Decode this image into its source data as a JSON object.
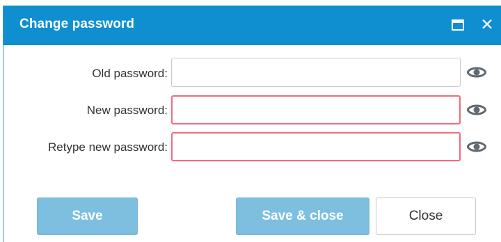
{
  "dialog": {
    "title": "Change password",
    "icons": {
      "maximize": "maximize-icon",
      "close": "close-icon",
      "show_password": "eye-icon"
    },
    "close_glyph": "✕"
  },
  "fields": [
    {
      "label": "Old password:",
      "value": "",
      "placeholder": "",
      "state": "normal"
    },
    {
      "label": "New password:",
      "value": "",
      "placeholder": "",
      "state": "invalid"
    },
    {
      "label": "Retype new password:",
      "value": "",
      "placeholder": "",
      "state": "invalid"
    }
  ],
  "buttons": {
    "save": "Save",
    "save_close": "Save & close",
    "close": "Close"
  },
  "colors": {
    "titlebar": "#0f8fd0",
    "primary_button": "#7ebfe0",
    "invalid_border": "#f26b7c",
    "eye_icon": "#5f6972"
  }
}
